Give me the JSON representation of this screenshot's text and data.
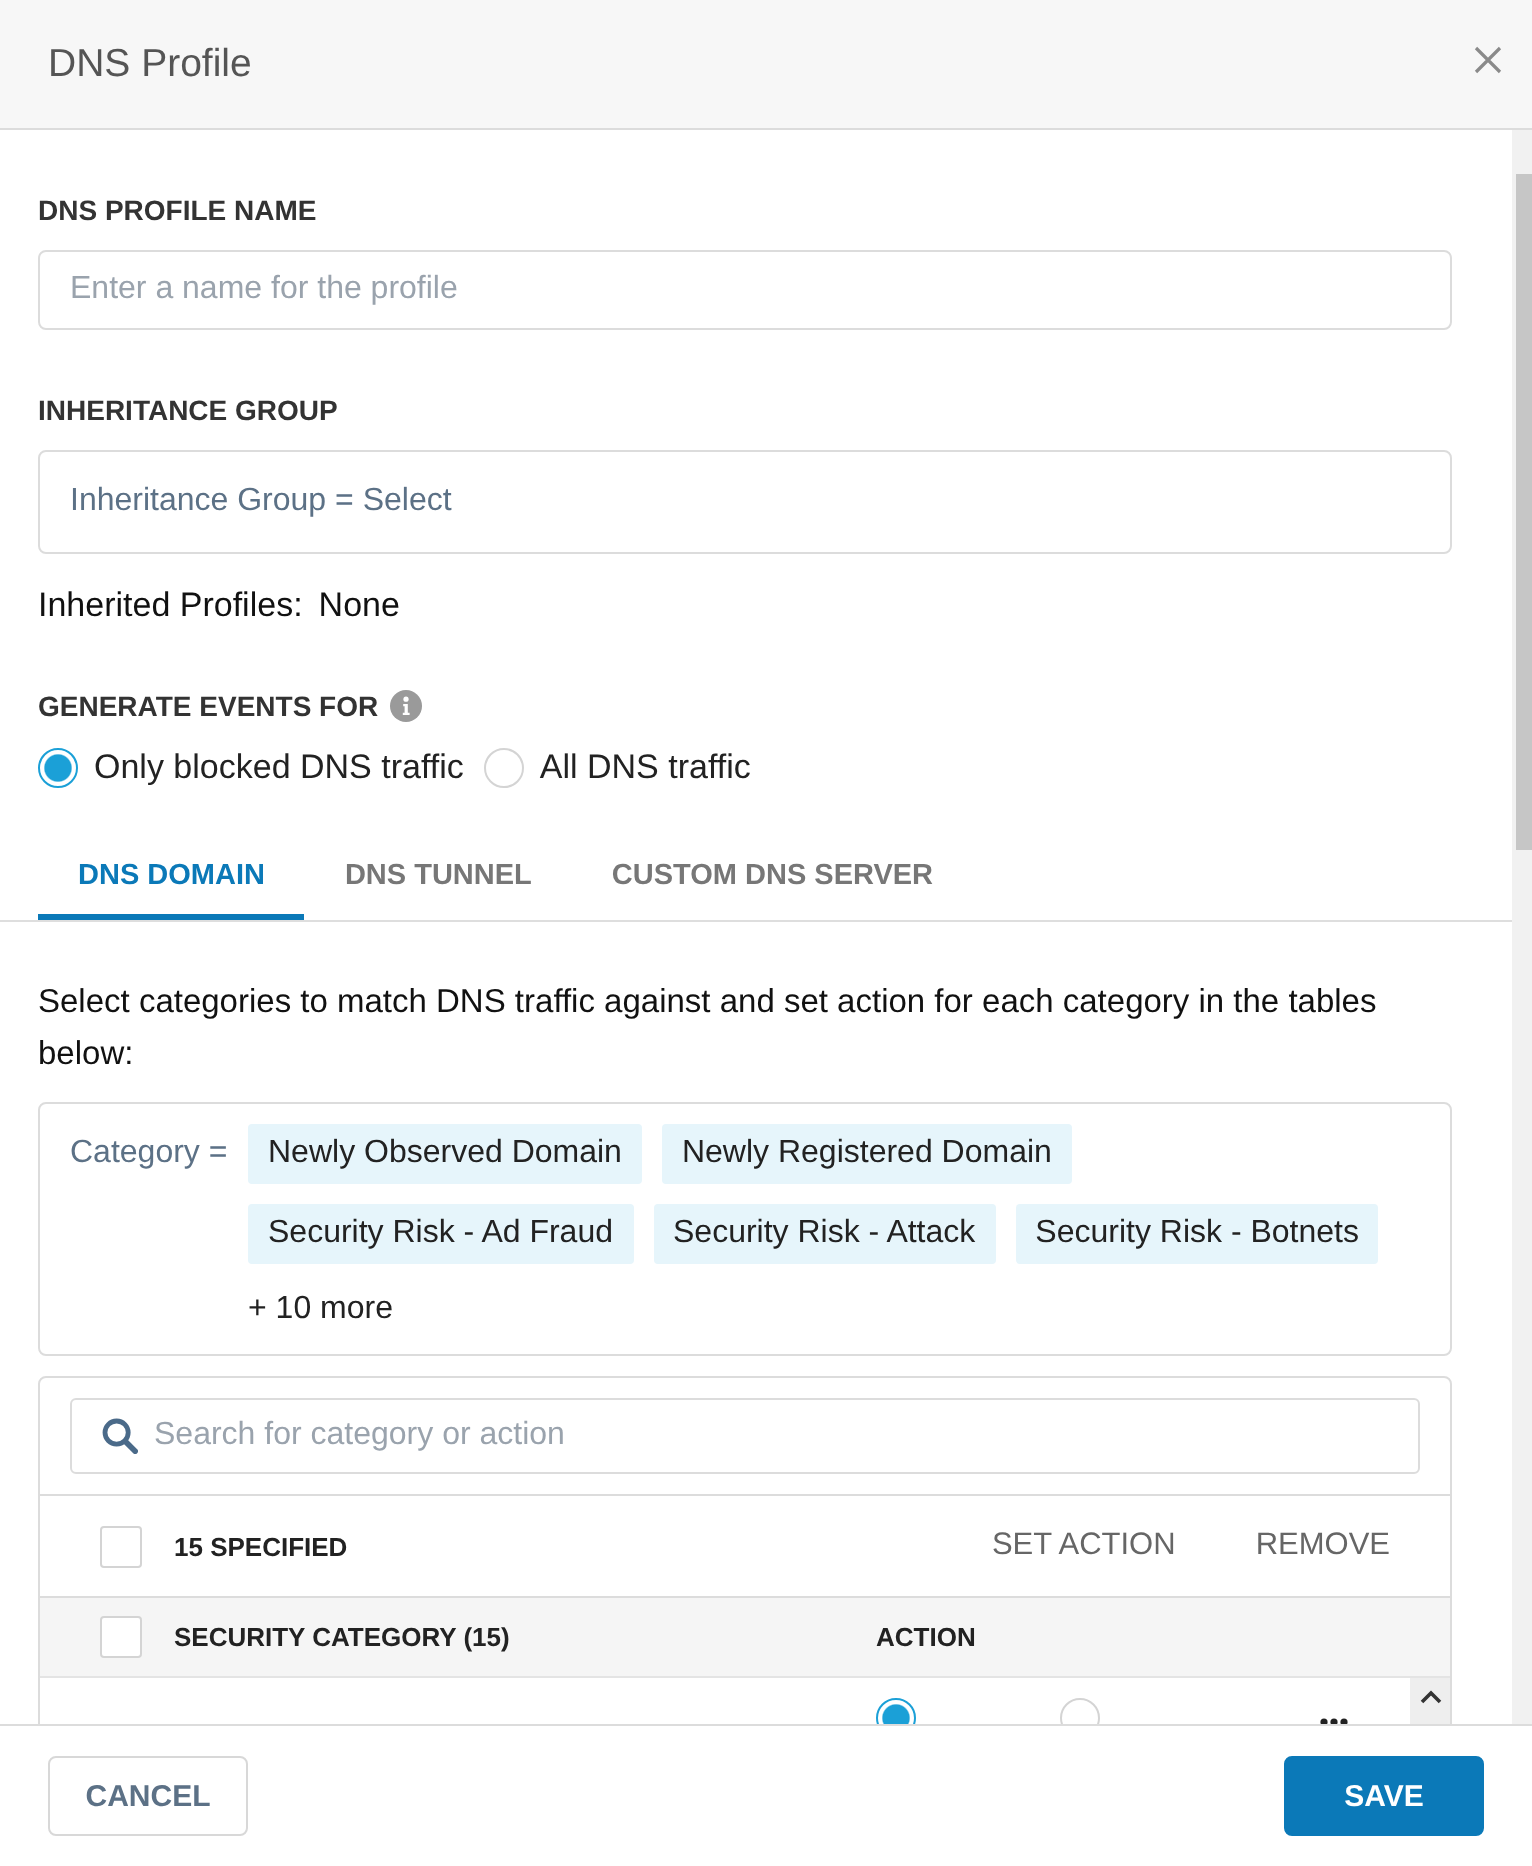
{
  "dialog": {
    "title": "DNS Profile"
  },
  "profile_name": {
    "label": "DNS PROFILE NAME",
    "placeholder": "Enter a name for the profile"
  },
  "inheritance_group": {
    "label": "INHERITANCE GROUP",
    "value": "Inheritance Group = Select"
  },
  "inherited_profiles": {
    "label": "Inherited Profiles:",
    "value": "None"
  },
  "generate_events": {
    "label": "GENERATE EVENTS FOR",
    "options": [
      {
        "label": "Only blocked DNS traffic",
        "selected": true
      },
      {
        "label": "All DNS traffic",
        "selected": false
      }
    ]
  },
  "tabs": [
    {
      "label": "DNS DOMAIN",
      "selected": true
    },
    {
      "label": "DNS TUNNEL",
      "selected": false
    },
    {
      "label": "CUSTOM DNS SERVER",
      "selected": false
    }
  ],
  "description": "Select categories to match DNS traffic against and set action for each category in the tables below:",
  "category_filter": {
    "label": "Category =",
    "chips": [
      "Newly Observed Domain",
      "Newly Registered Domain",
      "Security Risk - Ad Fraud",
      "Security Risk - Attack",
      "Security Risk - Botnets"
    ],
    "more": "+ 10 more"
  },
  "table": {
    "search": {
      "placeholder": "Search for category or action"
    },
    "bulk_bar": {
      "checked": false,
      "count": "15 SPECIFIED",
      "actions": [
        "SET ACTION",
        "REMOVE"
      ]
    },
    "header": {
      "checked": false,
      "columns": [
        "SECURITY CATEGORY (15)",
        "ACTION"
      ]
    },
    "rows": [
      {
        "actions": [
          {
            "selected": true
          },
          {
            "selected": false
          }
        ]
      }
    ]
  },
  "buttons": [
    {
      "label": "CANCEL",
      "kind": "secondary"
    },
    {
      "label": "SAVE",
      "kind": "primary"
    }
  ]
}
